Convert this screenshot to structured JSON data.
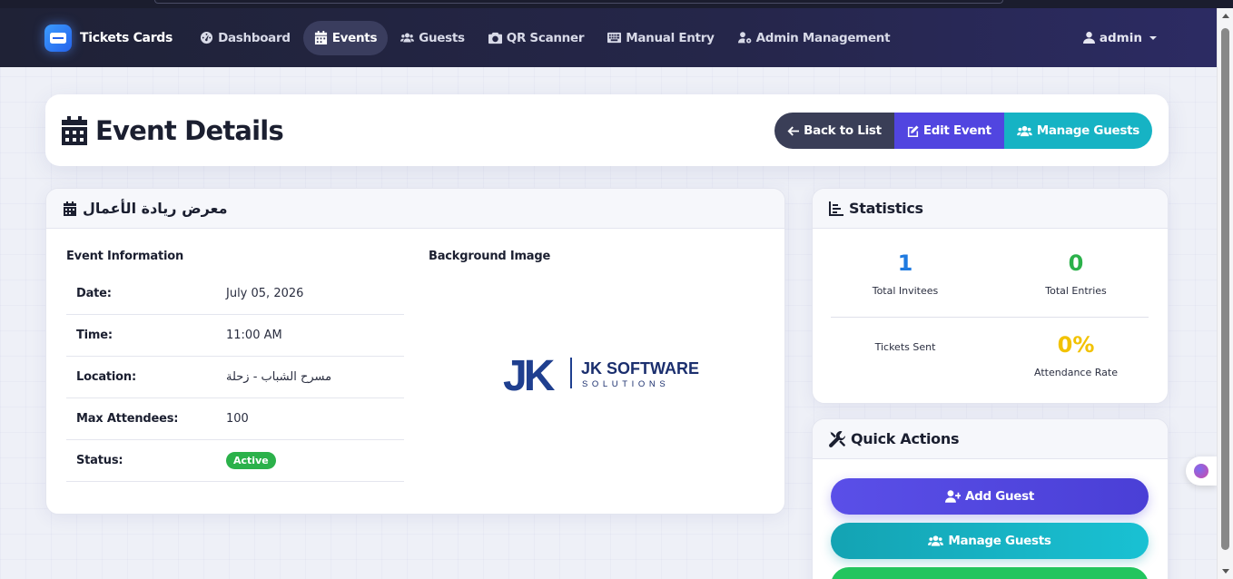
{
  "brand": {
    "name": "Tickets Cards"
  },
  "nav": {
    "items": [
      {
        "label": "Dashboard",
        "icon": "gauge-icon"
      },
      {
        "label": "Events",
        "icon": "calendar-icon",
        "active": true
      },
      {
        "label": "Guests",
        "icon": "users-icon"
      },
      {
        "label": "QR Scanner",
        "icon": "camera-icon"
      },
      {
        "label": "Manual Entry",
        "icon": "keyboard-icon"
      },
      {
        "label": "Admin Management",
        "icon": "user-gear-icon"
      }
    ],
    "user": "admin"
  },
  "header": {
    "title": "Event Details",
    "buttons": {
      "back": "Back to List",
      "edit": "Edit Event",
      "manage": "Manage Guests"
    }
  },
  "event": {
    "name": "معرض ريادة الأعمال",
    "info_label": "Event Information",
    "image_label": "Background Image",
    "rows": [
      {
        "key": "Date:",
        "value": "July 05, 2026"
      },
      {
        "key": "Time:",
        "value": "11:00 AM"
      },
      {
        "key": "Location:",
        "value": "مسرح الشباب - زحلة"
      },
      {
        "key": "Max Attendees:",
        "value": "100"
      },
      {
        "key": "Status:",
        "value": "Active"
      }
    ],
    "image_text": {
      "monogram": "JK",
      "line1": "JK SOFTWARE",
      "line2": "SOLUTIONS"
    }
  },
  "stats": {
    "title": "Statistics",
    "total_invitees": {
      "value": "1",
      "label": "Total Invitees"
    },
    "total_entries": {
      "value": "0",
      "label": "Total Entries"
    },
    "tickets_sent": {
      "label": "Tickets Sent"
    },
    "attendance_rate": {
      "value": "0%",
      "label": "Attendance Rate"
    }
  },
  "quick_actions": {
    "title": "Quick Actions",
    "add_guest": "Add Guest",
    "manage_guests": "Manage Guests"
  },
  "colors": {
    "accent_blue": "#1f7ae0",
    "accent_green": "#2bb14a",
    "accent_yellow": "#f2c200",
    "primary_purple": "#5145e0",
    "teal": "#16b3c4"
  }
}
